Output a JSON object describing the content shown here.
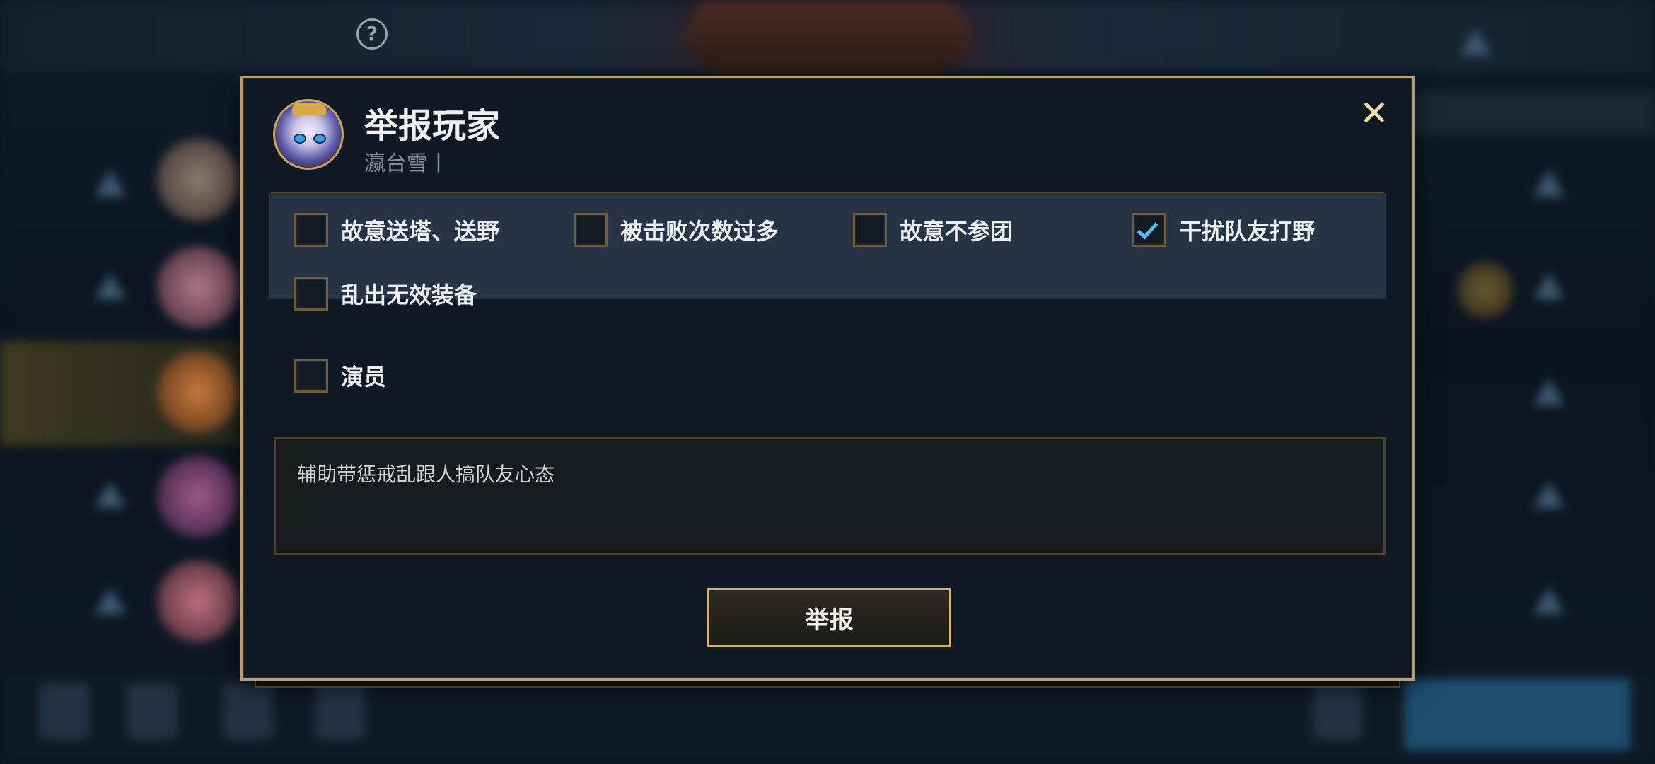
{
  "dialog": {
    "title": "举报玩家",
    "player_name": "瀛台雪丨",
    "close_symbol": "✕",
    "comment": "辅助带惩戒乱跟人搞队友心态",
    "submit_label": "举报"
  },
  "options": [
    {
      "label": "故意送塔、送野",
      "checked": false
    },
    {
      "label": "被击败次数过多",
      "checked": false
    },
    {
      "label": "故意不参团",
      "checked": false
    },
    {
      "label": "干扰队友打野",
      "checked": true
    },
    {
      "label": "乱出无效装备",
      "checked": false
    },
    {
      "label": "演员",
      "checked": false
    }
  ],
  "background": {
    "help_symbol": "?"
  },
  "colors": {
    "accent_gold": "#b99e6a",
    "check_blue": "#4fc0f2",
    "panel": "#263445",
    "dialog_bg": "#111a24"
  }
}
